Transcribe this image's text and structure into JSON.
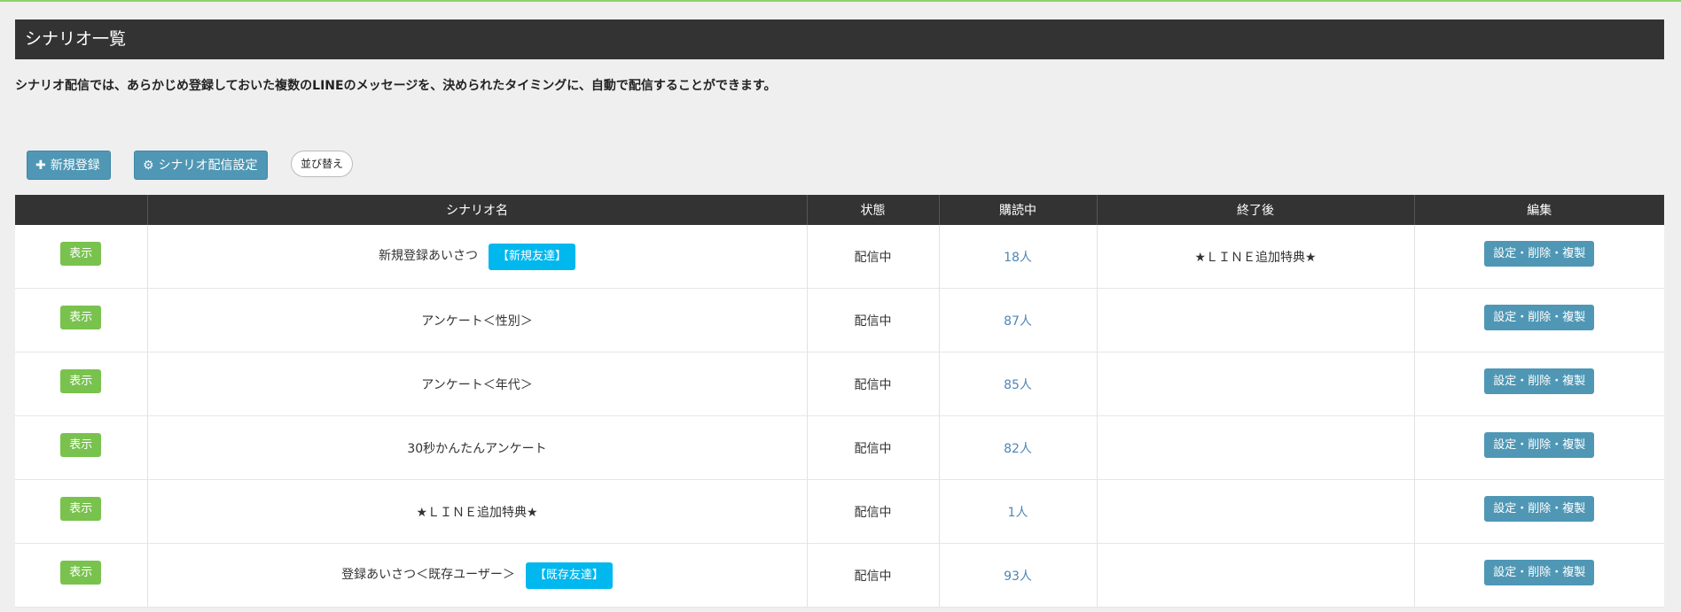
{
  "page": {
    "title": "シナリオ一覧",
    "description": "シナリオ配信では、あらかじめ登録しておいた複数のLINEのメッセージを、決められたタイミングに、自動で配信することができます。"
  },
  "toolbar": {
    "new_label": "新規登録",
    "settings_label": "シナリオ配信設定",
    "sort_label": "並び替え"
  },
  "table": {
    "headers": [
      "",
      "シナリオ名",
      "状態",
      "購読中",
      "終了後",
      "編集"
    ],
    "rows": [
      {
        "show": "表示",
        "name": "新規登録あいさつ",
        "tag": "【新規友達】",
        "status": "配信中",
        "subscribers": "18人",
        "after": "★ＬＩＮＥ追加特典★",
        "edit": "設定・削除・複製"
      },
      {
        "show": "表示",
        "name": "アンケート＜性別＞",
        "tag": "",
        "status": "配信中",
        "subscribers": "87人",
        "after": "",
        "edit": "設定・削除・複製"
      },
      {
        "show": "表示",
        "name": "アンケート＜年代＞",
        "tag": "",
        "status": "配信中",
        "subscribers": "85人",
        "after": "",
        "edit": "設定・削除・複製"
      },
      {
        "show": "表示",
        "name": "30秒かんたんアンケート",
        "tag": "",
        "status": "配信中",
        "subscribers": "82人",
        "after": "",
        "edit": "設定・削除・複製"
      },
      {
        "show": "表示",
        "name": "★ＬＩＮＥ追加特典★",
        "tag": "",
        "status": "配信中",
        "subscribers": "1人",
        "after": "",
        "edit": "設定・削除・複製"
      },
      {
        "show": "表示",
        "name": "登録あいさつ＜既存ユーザー＞",
        "tag": "【既存友達】",
        "status": "配信中",
        "subscribers": "93人",
        "after": "",
        "edit": "設定・削除・複製"
      }
    ]
  },
  "colors": {
    "header_bg": "#333333",
    "show_button": "#79c24e",
    "action_button": "#4f97b5",
    "tag": "#00b7ee",
    "count_text": "#4e86b5"
  }
}
